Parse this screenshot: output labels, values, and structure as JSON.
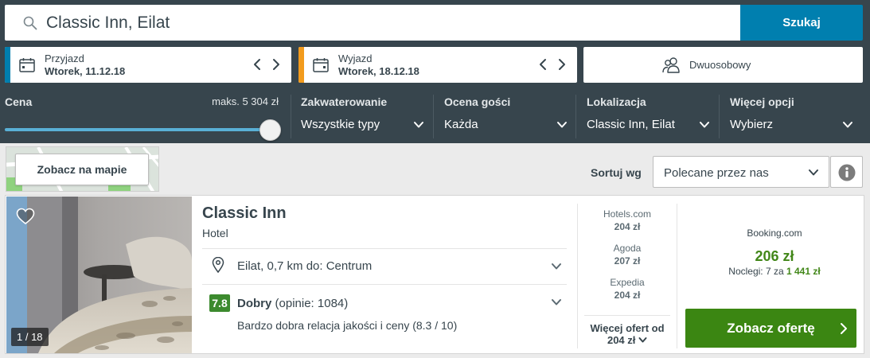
{
  "search": {
    "value": "Classic Inn, Eilat",
    "button_label": "Szukaj"
  },
  "dates": {
    "checkin": {
      "label": "Przyjazd",
      "value": "Wtorek, 11.12.18",
      "accent_color": "#007faf"
    },
    "checkout": {
      "label": "Wyjazd",
      "value": "Wtorek, 18.12.18",
      "accent_color": "#f29b1d"
    }
  },
  "room": {
    "label": "Dwuosobowy"
  },
  "filters": {
    "price": {
      "title": "Cena",
      "max_label": "maks. 5 304 zł",
      "slider_fraction": 1.0
    },
    "accommodation": {
      "title": "Zakwaterowanie",
      "value": "Wszystkie typy"
    },
    "guest_rating": {
      "title": "Ocena gości",
      "value": "Każda"
    },
    "location": {
      "title": "Lokalizacja",
      "value": "Classic Inn, Eilat"
    },
    "more": {
      "title": "Więcej opcji",
      "value": "Wybierz"
    }
  },
  "toolbar": {
    "map_button": "Zobacz na mapie",
    "sort_label": "Sortuj wg",
    "sort_value": "Polecane przez nas"
  },
  "result": {
    "name": "Classic Inn",
    "type": "Hotel",
    "photo_counter": "1 / 18",
    "location": "Eilat, 0,7 km do: Centrum",
    "rating": {
      "score": "7.8",
      "label": "Dobry",
      "reviews": "(opinie: 1084)",
      "value_text": "Bardzo dobra relacja jakości i ceny (8.3 / 10)",
      "score_color": "#3c8a2e"
    },
    "partners": [
      {
        "name": "Hotels.com",
        "price": "204 zł"
      },
      {
        "name": "Agoda",
        "price": "207 zł"
      },
      {
        "name": "Expedia",
        "price": "204 zł"
      }
    ],
    "more_offers": {
      "label": "Więcej ofert od",
      "price": "204 zł"
    },
    "deal": {
      "site": "Booking.com",
      "price": "206 zł",
      "nights_prefix": "Noclegi: 7 za",
      "total": "1 441 zł",
      "cta": "Zobacz ofertę",
      "cta_color": "#3b8612"
    }
  }
}
